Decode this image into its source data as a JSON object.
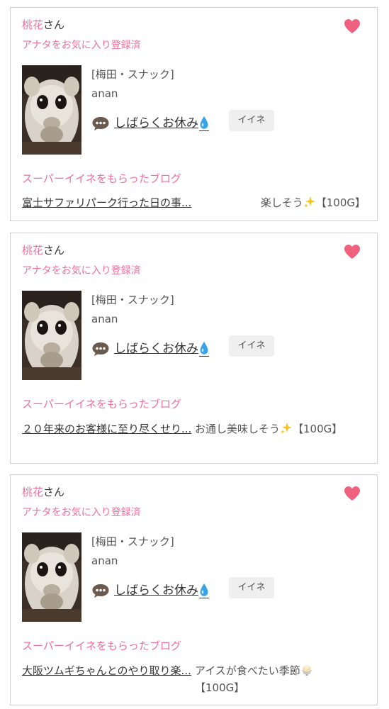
{
  "colors": {
    "accent_pink": "#ee6f9d",
    "heart": "#f0617f",
    "button_bg": "#efefef",
    "border": "#cfcfcf"
  },
  "cards": [
    {
      "user_name": "桃花",
      "user_suffix": "さん",
      "favorite_status": "アナタをお気に入り登録済",
      "heart_icon": "heart-icon",
      "shop": "[梅田・スナック]",
      "cast": "anan",
      "status_icon": "speech-bubble-icon",
      "status_text": "しばらくお休み",
      "status_emoji": "droplet-icon",
      "iine_label": "イイネ",
      "blog_section_heading": "スーパーイイネをもらったブログ",
      "blog_title": "富士サファリパーク行った日の事...",
      "blog_comment": "楽しそう",
      "comment_emoji": "sparkles-icon",
      "comment_points": "【100G】"
    },
    {
      "user_name": "桃花",
      "user_suffix": "さん",
      "favorite_status": "アナタをお気に入り登録済",
      "heart_icon": "heart-icon",
      "shop": "[梅田・スナック]",
      "cast": "anan",
      "status_icon": "speech-bubble-icon",
      "status_text": "しばらくお休み",
      "status_emoji": "droplet-icon",
      "iine_label": "イイネ",
      "blog_section_heading": "スーパーイイネをもらったブログ",
      "blog_title": "２０年来のお客様に至り尽くせり...",
      "blog_comment": "お通し美味しそう",
      "comment_emoji": "sparkles-icon",
      "comment_points": "【100G】"
    },
    {
      "user_name": "桃花",
      "user_suffix": "さん",
      "favorite_status": "アナタをお気に入り登録済",
      "heart_icon": "heart-icon",
      "shop": "[梅田・スナック]",
      "cast": "anan",
      "status_icon": "speech-bubble-icon",
      "status_text": "しばらくお休み",
      "status_emoji": "droplet-icon",
      "iine_label": "イイネ",
      "blog_section_heading": "スーパーイイネをもらったブログ",
      "blog_title": "大阪ツムギちゃんとのやり取り楽...",
      "blog_comment": "アイスが食べたい季節",
      "comment_emoji": "shaved-ice-icon",
      "comment_points": "【100G】"
    }
  ]
}
